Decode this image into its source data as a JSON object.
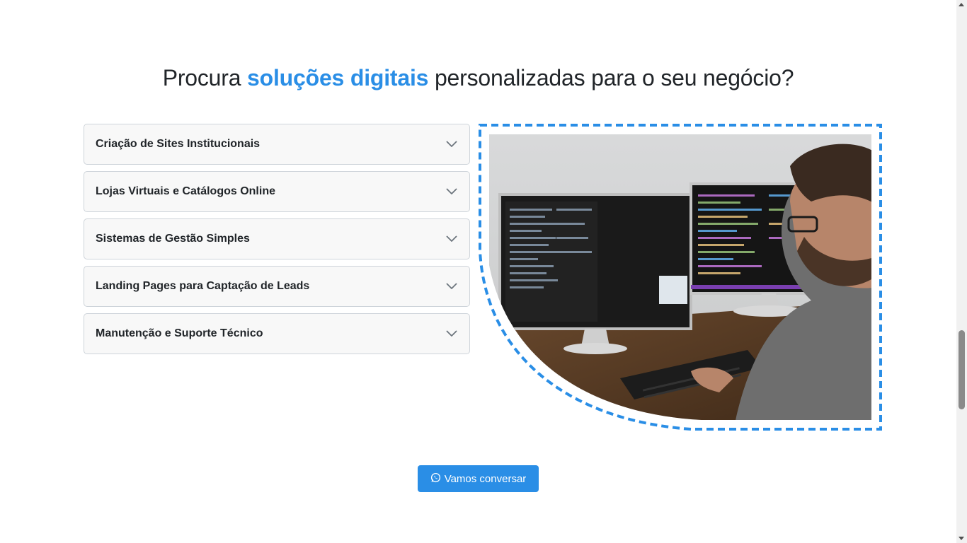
{
  "headline": {
    "prefix": "Procura ",
    "highlight": "soluções digitais",
    "suffix": " personalizadas para o seu negócio?"
  },
  "accordion": {
    "items": [
      {
        "label": "Criação de Sites Institucionais"
      },
      {
        "label": "Lojas Virtuais e Catálogos Online"
      },
      {
        "label": "Sistemas de Gestão Simples"
      },
      {
        "label": "Landing Pages para Captação de Leads"
      },
      {
        "label": "Manutenção e Suporte Técnico"
      }
    ]
  },
  "image": {
    "description_icon": "developer-at-monitors-photo"
  },
  "cta": {
    "label": "Vamos conversar",
    "icon": "whatsapp-icon"
  },
  "colors": {
    "accent": "#2a8ee6"
  }
}
